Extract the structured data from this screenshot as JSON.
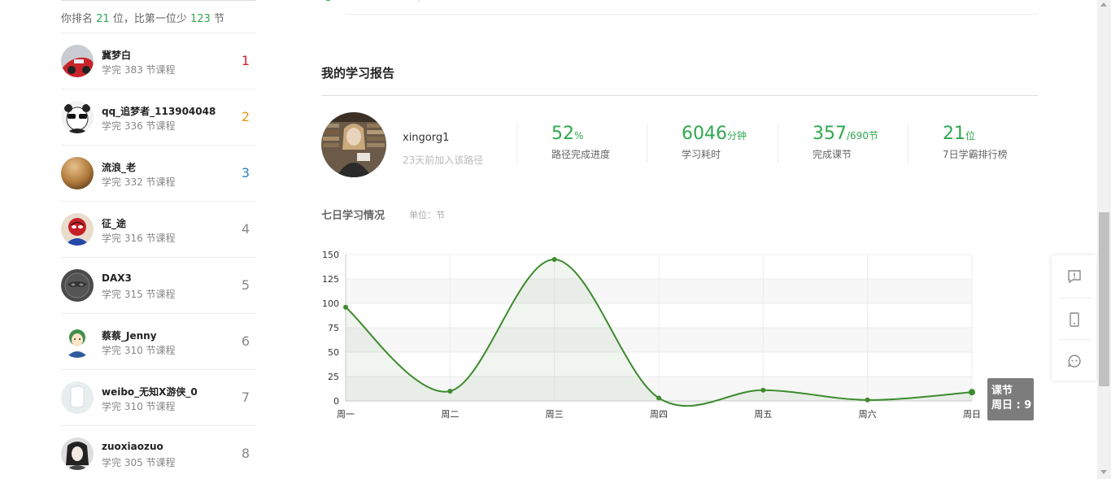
{
  "ranking": {
    "summary_prefix": "你排名",
    "my_rank": "21",
    "summary_mid": "位，比第一位少",
    "gap": "123",
    "summary_suffix": "节",
    "items": [
      {
        "name": "冀梦白",
        "desc": "学完 383 节课程",
        "rank": "1"
      },
      {
        "name": "qq_追梦者_113904048",
        "desc": "学完 336 节课程",
        "rank": "2"
      },
      {
        "name": "流浪_老",
        "desc": "学完 332 节课程",
        "rank": "3"
      },
      {
        "name": "征_途",
        "desc": "学完 316 节课程",
        "rank": "4"
      },
      {
        "name": "DAX3",
        "desc": "学完 315 节课程",
        "rank": "5"
      },
      {
        "name": "蔡蔡_Jenny",
        "desc": "学完 310 节课程",
        "rank": "6"
      },
      {
        "name": "weibo_无知X游侠_0",
        "desc": "学完 310 节课程",
        "rank": "7"
      },
      {
        "name": "zuoxiaozuo",
        "desc": "学完 305 节课程",
        "rank": "8"
      }
    ]
  },
  "report": {
    "title": "我的学习报告",
    "username": "xingorg1",
    "joined": "23天前加入该路径",
    "stats": [
      {
        "value": "52",
        "unit": "%",
        "label": "路径完成进度"
      },
      {
        "value": "6046",
        "unit": "分钟",
        "label": "学习耗时"
      },
      {
        "value": "357",
        "unit": "/690节",
        "label": "完成课节"
      },
      {
        "value": "21",
        "unit": "位",
        "label": "7日学霸排行榜"
      }
    ],
    "chart_title": "七日学习情况",
    "chart_unit": "单位：节"
  },
  "tooltip": {
    "label": "课节",
    "value": "周日 : 9"
  },
  "side_tools": [
    "feedback-icon",
    "mobile-icon",
    "service-icon"
  ],
  "colors": {
    "accent": "#2fa84f",
    "line": "#3d8b2e",
    "rank1": "#d0232a",
    "rank2": "#e39d1b",
    "rank3": "#2c7fbf"
  },
  "chart_data": {
    "type": "area",
    "categories": [
      "周一",
      "周二",
      "周三",
      "周四",
      "周五",
      "周六",
      "周日"
    ],
    "series": [
      {
        "name": "课节",
        "values": [
          96,
          10,
          145,
          3,
          11,
          1,
          9
        ]
      }
    ],
    "ylim": [
      0,
      150
    ],
    "yticks": [
      0,
      25,
      50,
      75,
      100,
      125,
      150
    ],
    "title": "七日学习情况",
    "ylabel": "单位：节",
    "grid": true
  }
}
